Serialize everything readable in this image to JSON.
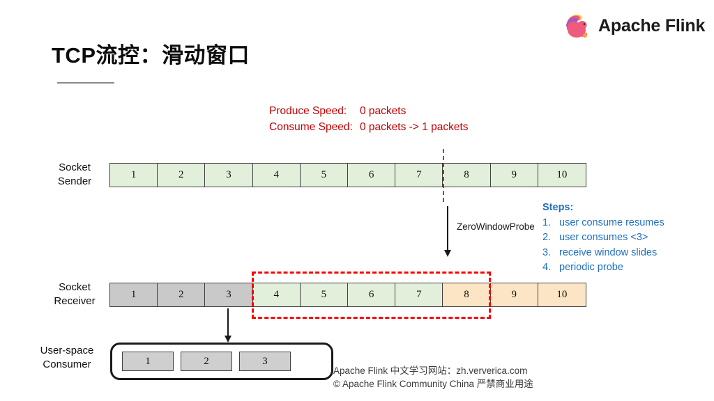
{
  "header": {
    "logo_name": "apache-flink-squirrel-logo",
    "brand": "Apache Flink"
  },
  "title": "TCP流控：滑动窗口",
  "annotations": {
    "produce_label": "Produce Speed:",
    "produce_value": "0 packets",
    "consume_label": "Consume Speed:",
    "consume_value": "0 packets -> 1 packets",
    "accent_color": "#c00000"
  },
  "sender": {
    "label_line1": "Socket",
    "label_line2": "Sender",
    "cells": [
      {
        "value": "1",
        "state": "green"
      },
      {
        "value": "2",
        "state": "green"
      },
      {
        "value": "3",
        "state": "green"
      },
      {
        "value": "4",
        "state": "green"
      },
      {
        "value": "5",
        "state": "green"
      },
      {
        "value": "6",
        "state": "green"
      },
      {
        "value": "7",
        "state": "green"
      },
      {
        "value": "8",
        "state": "green"
      },
      {
        "value": "9",
        "state": "green"
      },
      {
        "value": "10",
        "state": "green"
      }
    ]
  },
  "probe": {
    "label": "ZeroWindowProbe"
  },
  "steps": {
    "title": "Steps:",
    "color": "#1f6fc0",
    "items": [
      {
        "num": "1.",
        "text": "user consume resumes"
      },
      {
        "num": "2.",
        "text": "user consumes <3>"
      },
      {
        "num": "3.",
        "text": "receive window slides"
      },
      {
        "num": "4.",
        "text": "periodic probe"
      }
    ]
  },
  "receiver": {
    "label_line1": "Socket",
    "label_line2": "Receiver",
    "cells": [
      {
        "value": "1",
        "state": "gray"
      },
      {
        "value": "2",
        "state": "gray"
      },
      {
        "value": "3",
        "state": "gray"
      },
      {
        "value": "4",
        "state": "green"
      },
      {
        "value": "5",
        "state": "green"
      },
      {
        "value": "6",
        "state": "green"
      },
      {
        "value": "7",
        "state": "green"
      },
      {
        "value": "8",
        "state": "orange"
      },
      {
        "value": "9",
        "state": "orange"
      },
      {
        "value": "10",
        "state": "orange"
      }
    ]
  },
  "consumer": {
    "label_line1": "User-space",
    "label_line2": "Consumer",
    "cells": [
      {
        "value": "1"
      },
      {
        "value": "2"
      },
      {
        "value": "3"
      }
    ]
  },
  "footer": {
    "line1": "Apache Flink 中文学习网站：zh.ververica.com",
    "line2": "© Apache Flink Community China  严禁商业用途"
  },
  "colors": {
    "cell_green": "#e2efda",
    "cell_gray": "#c9c9c9",
    "cell_orange": "#fce5c4",
    "dashed_red": "#ff0000",
    "steps_blue": "#1f6fc0"
  }
}
